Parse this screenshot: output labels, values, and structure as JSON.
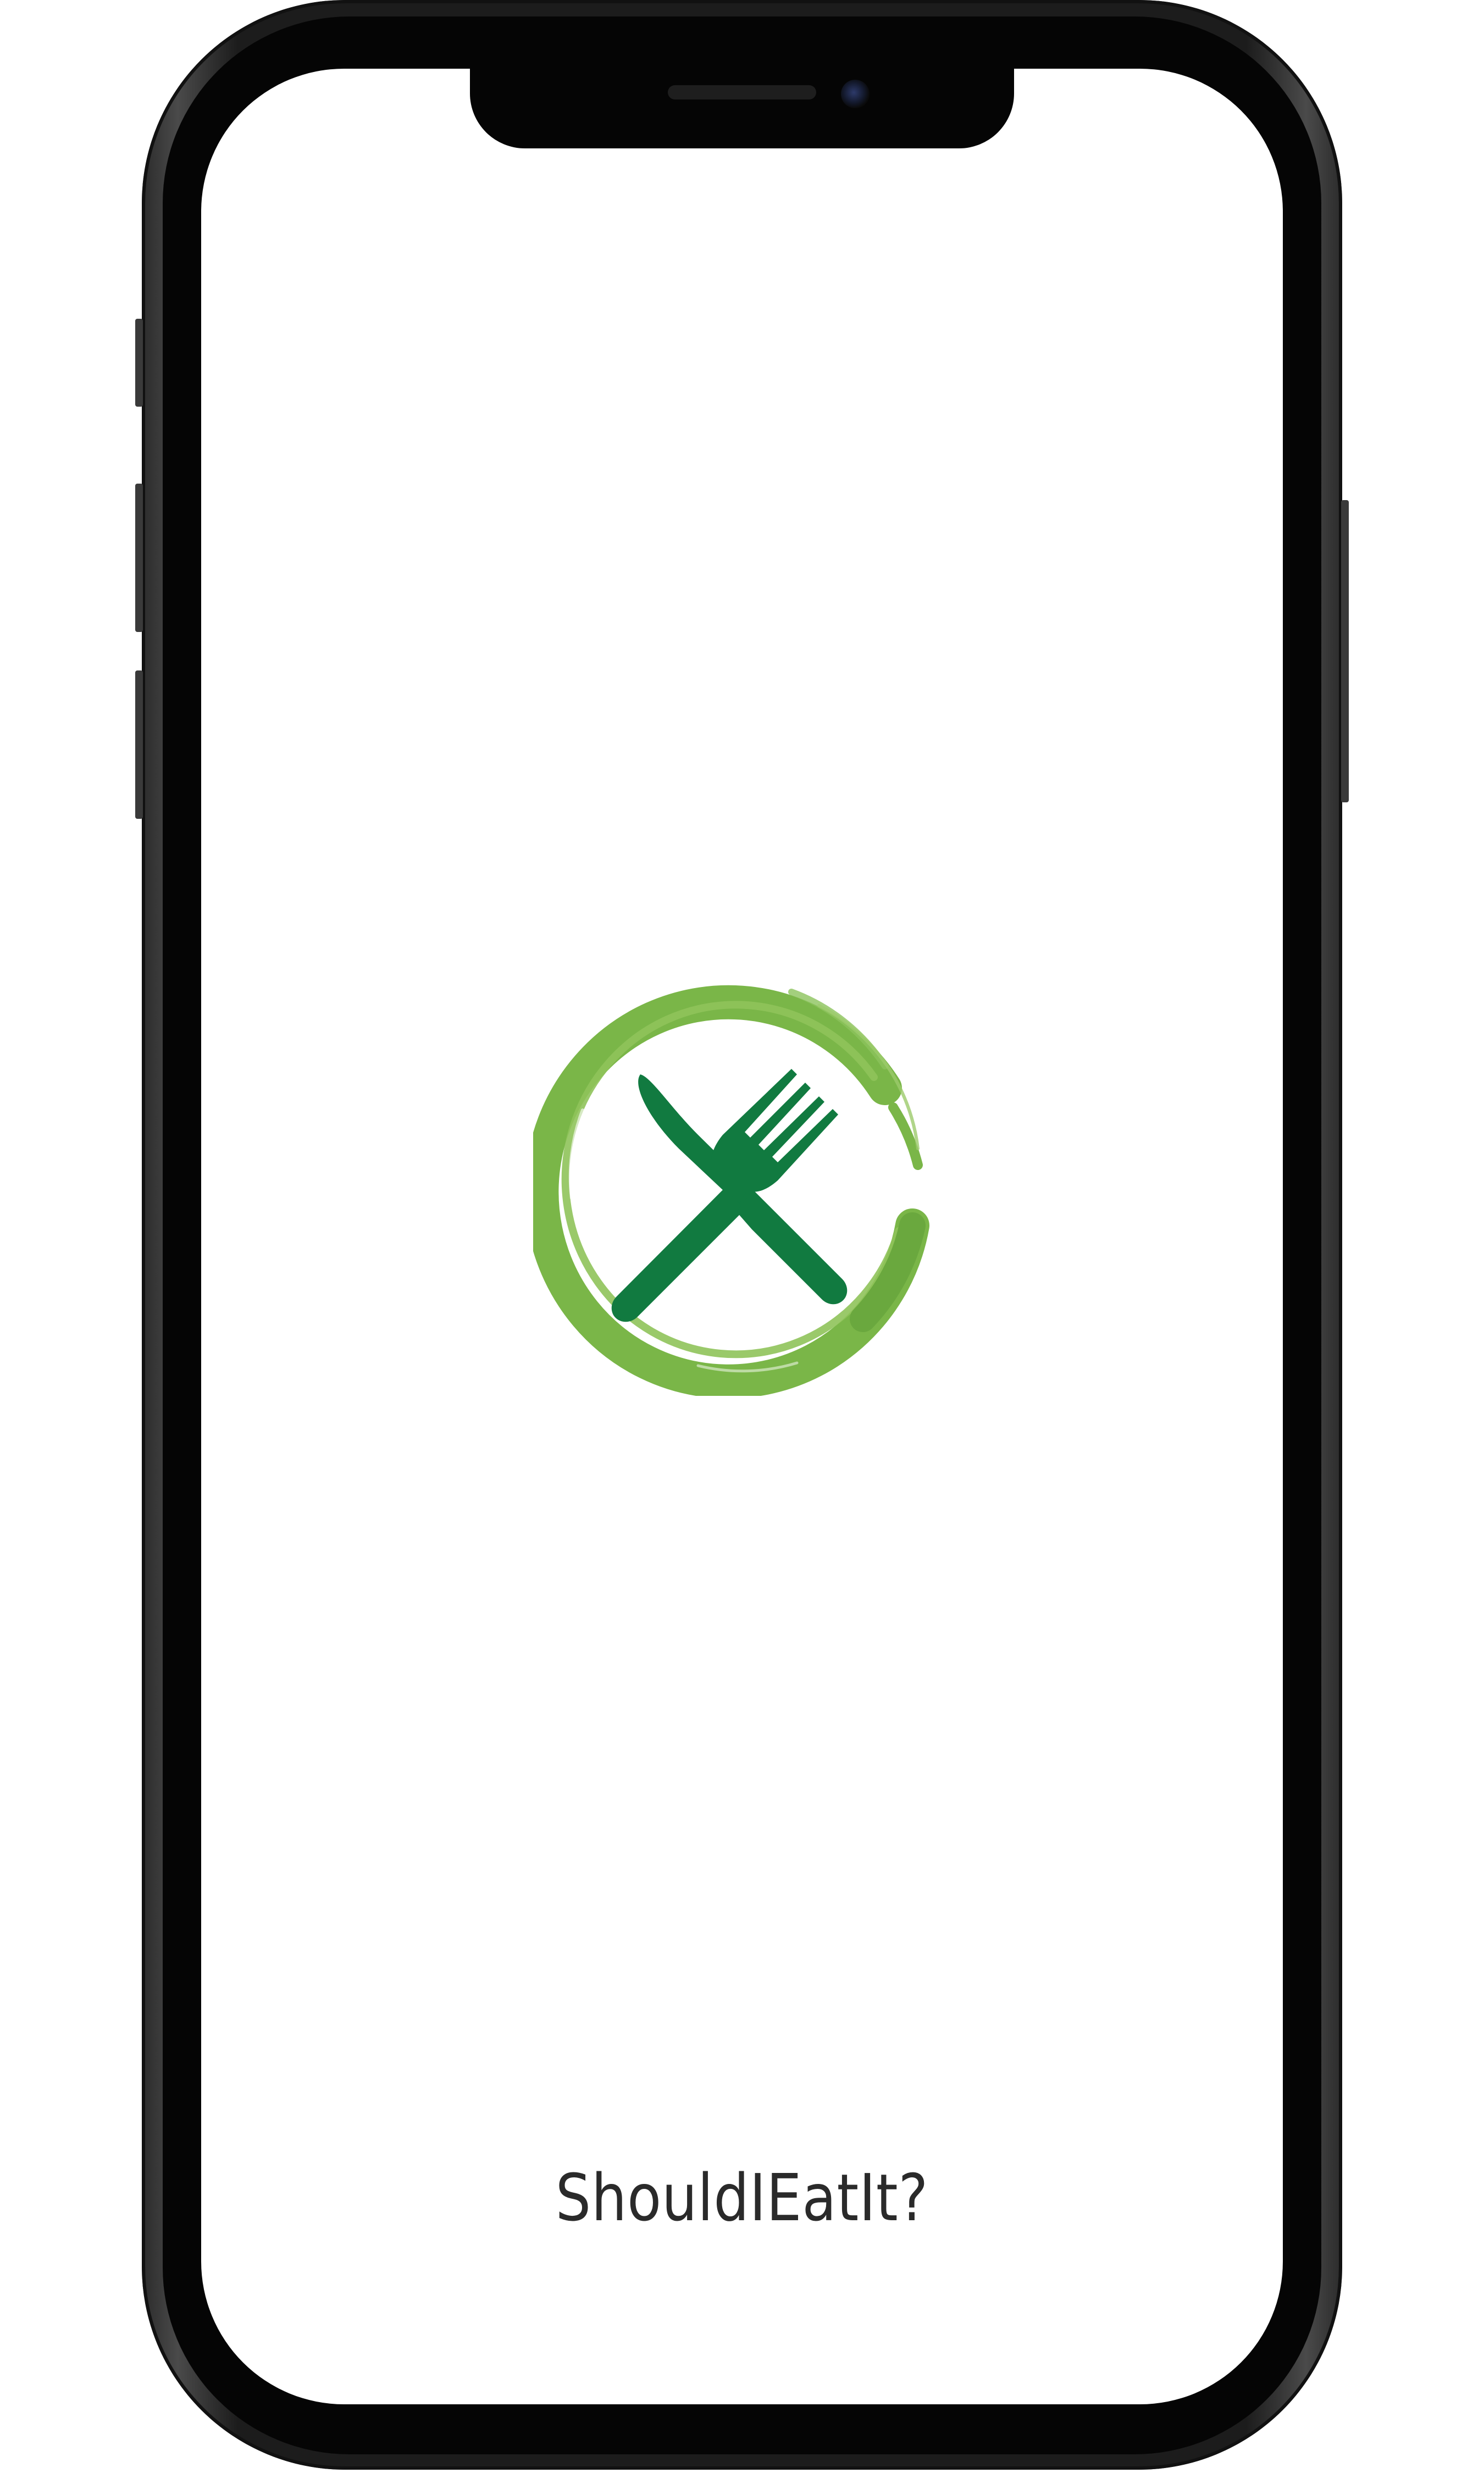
{
  "app": {
    "name": "ShouldIEatIt?"
  },
  "logo": {
    "icon": "crossed-knife-fork-in-brush-circle",
    "ring_color": "#7ab648",
    "utensil_color": "#117a40"
  },
  "device": {
    "frame_color": "#1c1c1c"
  }
}
